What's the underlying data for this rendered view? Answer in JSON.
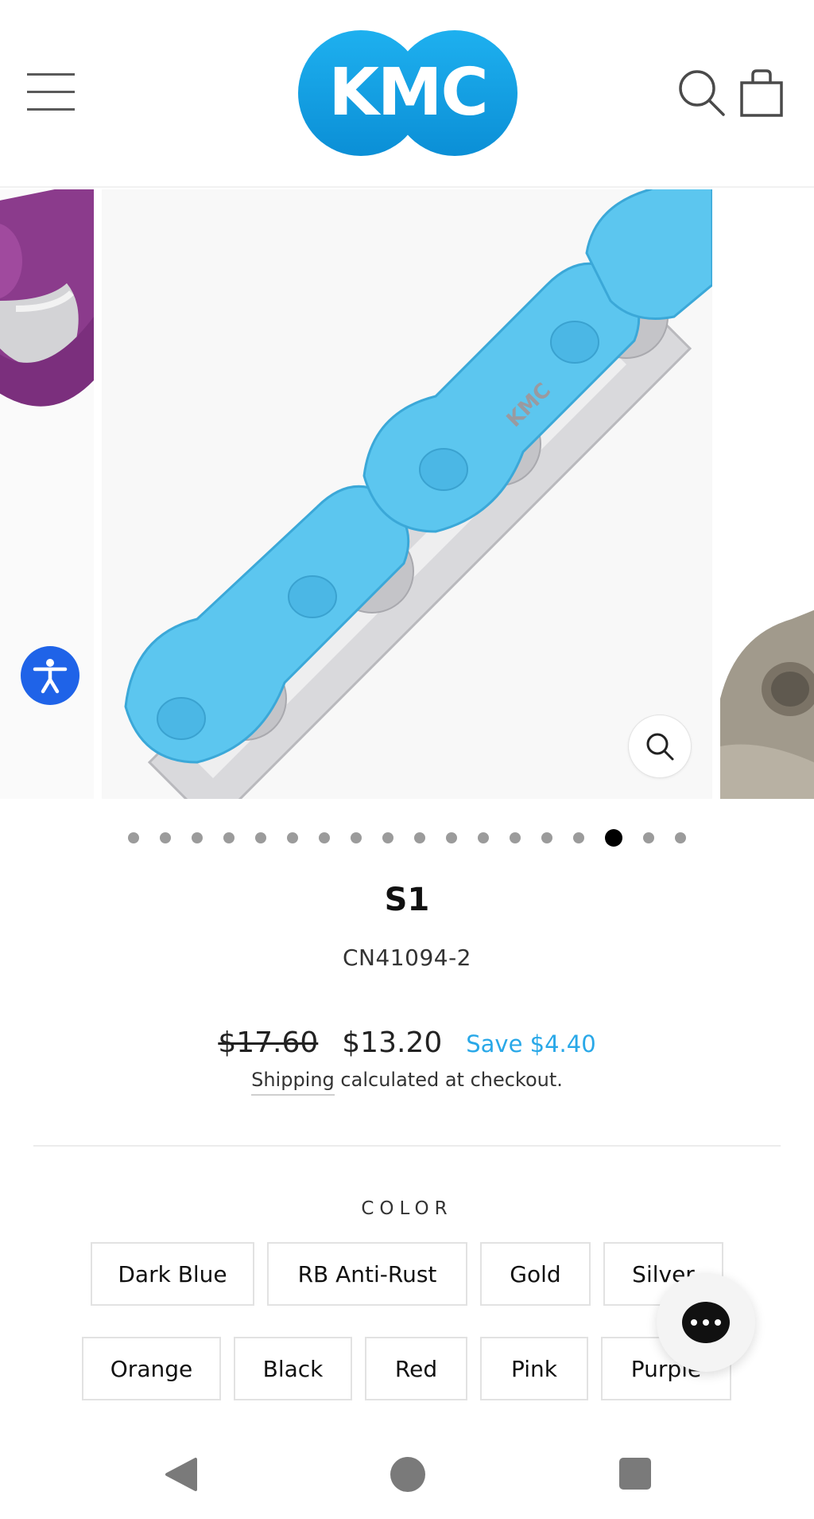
{
  "header": {
    "logo_text": "KMC",
    "menu_icon": "hamburger-menu-icon",
    "search_icon": "search-icon",
    "cart_icon": "shopping-bag-icon"
  },
  "gallery": {
    "total_slides": 18,
    "active_index": 15,
    "zoom_icon": "zoom-search-icon",
    "main_chain_color": "#5cc6ef",
    "prev_chain_color": "#8b3b8c",
    "next_chain_color": "#a19a8c",
    "chain_branding": "KMC"
  },
  "accessibility": {
    "icon": "accessibility-person-icon"
  },
  "product": {
    "title": "S1",
    "sku": "CN41094-2",
    "price_original": "$17.60",
    "price_sale": "$13.20",
    "savings": "Save $4.40",
    "shipping_link": "Shipping",
    "shipping_suffix": " calculated at checkout."
  },
  "options": {
    "label": "COLOR",
    "colors": [
      "Dark Blue",
      "RB Anti-Rust",
      "Gold",
      "Silver",
      "Orange",
      "Black",
      "Red",
      "Pink",
      "Purple"
    ]
  },
  "chat": {
    "icon": "chat-bubble-icon"
  },
  "system_nav": {
    "back_icon": "back-triangle-icon",
    "home_icon": "home-circle-icon",
    "recents_icon": "recents-square-icon"
  },
  "colors": {
    "accent": "#29a8e8",
    "brand_blue": "#139fe0",
    "a11y_blue": "#1f63e8"
  }
}
